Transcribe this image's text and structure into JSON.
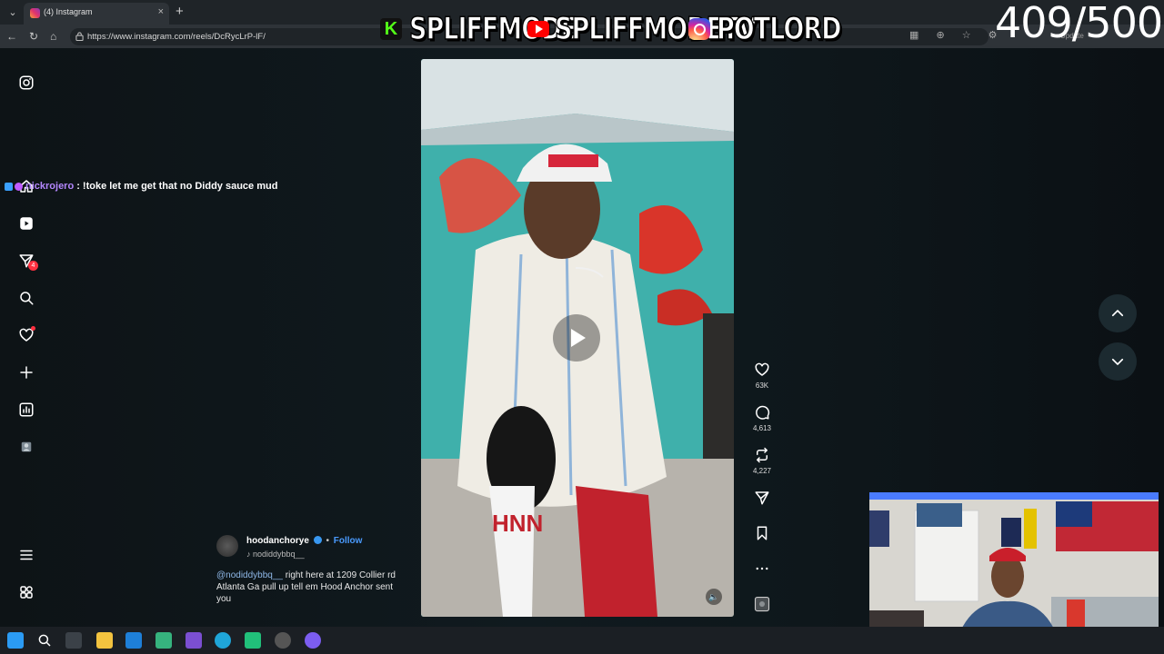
{
  "browser": {
    "tab_title": "(4) Instagram",
    "url": "https://www.instagram.com/reels/DcRycLrP-lF/",
    "close_glyph": "×",
    "new_tab_glyph": "+",
    "back_glyph": "←",
    "reload_glyph": "↻",
    "home_glyph": "⌂",
    "update_label": "Update"
  },
  "overlay": {
    "kick_glyph": "K",
    "kick_name": "SPLIFFMODE",
    "youtube_name": "SPLIFFMODETV",
    "instagram_name": "POTLORD",
    "counter": "409/500"
  },
  "chat": {
    "user": "nickrojero",
    "message": ": !toke let me get that no Diddy sauce mud"
  },
  "sidebar": {
    "icons": [
      "instagram-logo-icon",
      "home-icon",
      "reels-icon",
      "messages-icon",
      "search-icon",
      "notifications-icon",
      "create-icon",
      "dashboard-icon",
      "profile-icon",
      "more-menu-icon",
      "also-from-meta-icon"
    ],
    "messages_badge": "4"
  },
  "reel": {
    "actions": [
      {
        "name": "like",
        "count": "63K"
      },
      {
        "name": "comment",
        "count": "4,613"
      },
      {
        "name": "repost",
        "count": "4,227"
      },
      {
        "name": "share",
        "count": ""
      },
      {
        "name": "save",
        "count": ""
      },
      {
        "name": "more",
        "count": ""
      }
    ],
    "mute_glyph": "🔈"
  },
  "caption": {
    "username": "hoodanchorye",
    "separator": "•",
    "follow_label": "Follow",
    "audio": "nodiddybbq__",
    "mention": "@nodiddybbq__",
    "text": " right here at 1209 Collier rd Atlanta Ga pull up tell em Hood Anchor sent you"
  },
  "colors": {
    "accent": "#4a9bff",
    "badge": "#ff3040",
    "background": "#0d1316"
  }
}
